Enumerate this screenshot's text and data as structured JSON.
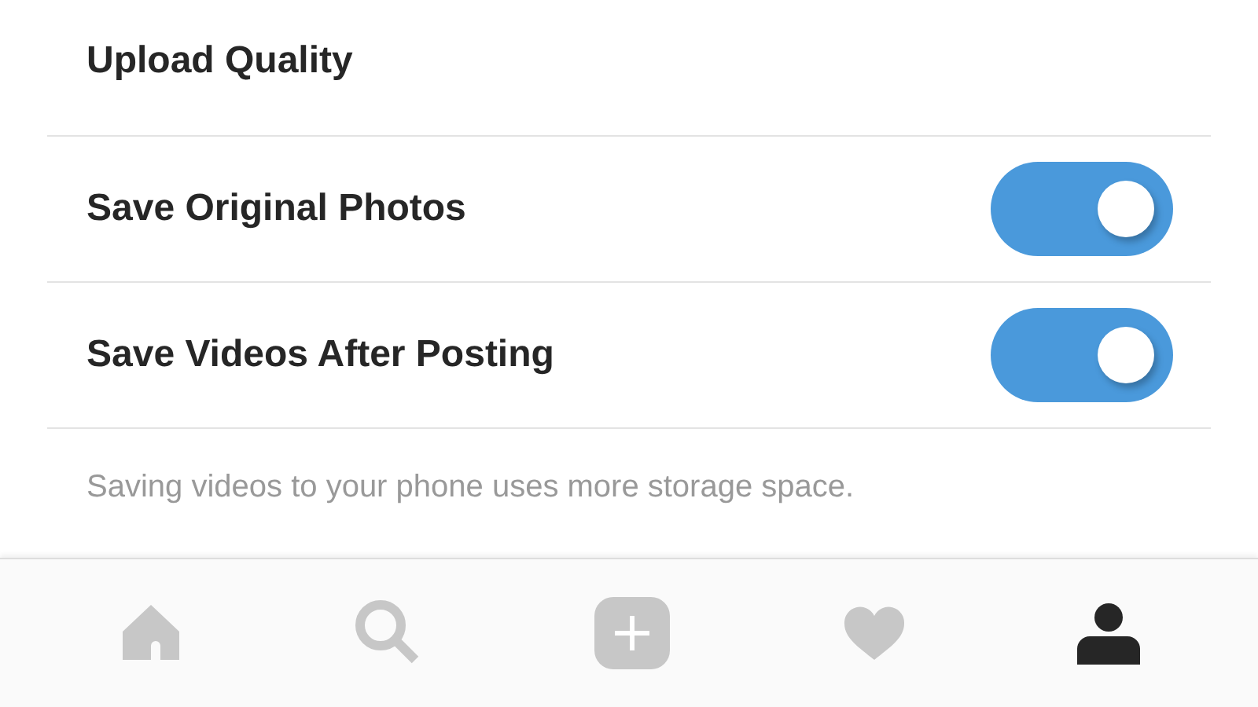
{
  "section_title": "Upload Quality",
  "settings": [
    {
      "label": "Save Original Photos",
      "on": true
    },
    {
      "label": "Save Videos After Posting",
      "on": true
    }
  ],
  "note": "Saving videos to your phone uses more storage space.",
  "tabs": [
    {
      "kind": "home",
      "selected": false
    },
    {
      "kind": "search",
      "selected": false
    },
    {
      "kind": "add",
      "selected": false
    },
    {
      "kind": "activity",
      "selected": false
    },
    {
      "kind": "profile",
      "selected": true
    }
  ]
}
